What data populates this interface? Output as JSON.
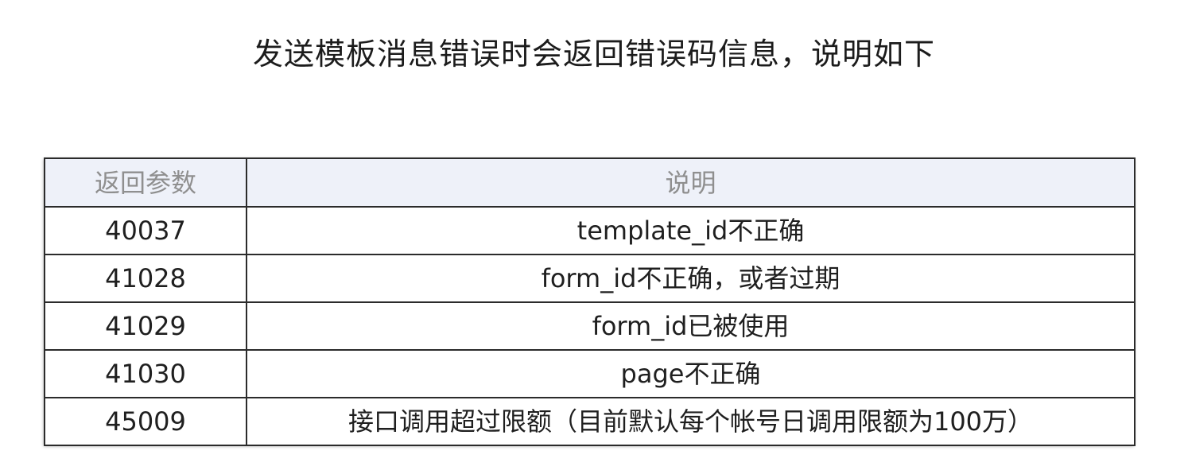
{
  "title": "发送模板消息错误时会返回错误码信息，说明如下",
  "table": {
    "headers": [
      "返回参数",
      "说明"
    ],
    "rows": [
      {
        "code": "40037",
        "desc": "template_id不正确"
      },
      {
        "code": "41028",
        "desc": "form_id不正确，或者过期"
      },
      {
        "code": "41029",
        "desc": "form_id已被使用"
      },
      {
        "code": "41030",
        "desc": "page不正确"
      },
      {
        "code": "45009",
        "desc": "接口调用超过限额（目前默认每个帐号日调用限额为100万）"
      }
    ]
  }
}
